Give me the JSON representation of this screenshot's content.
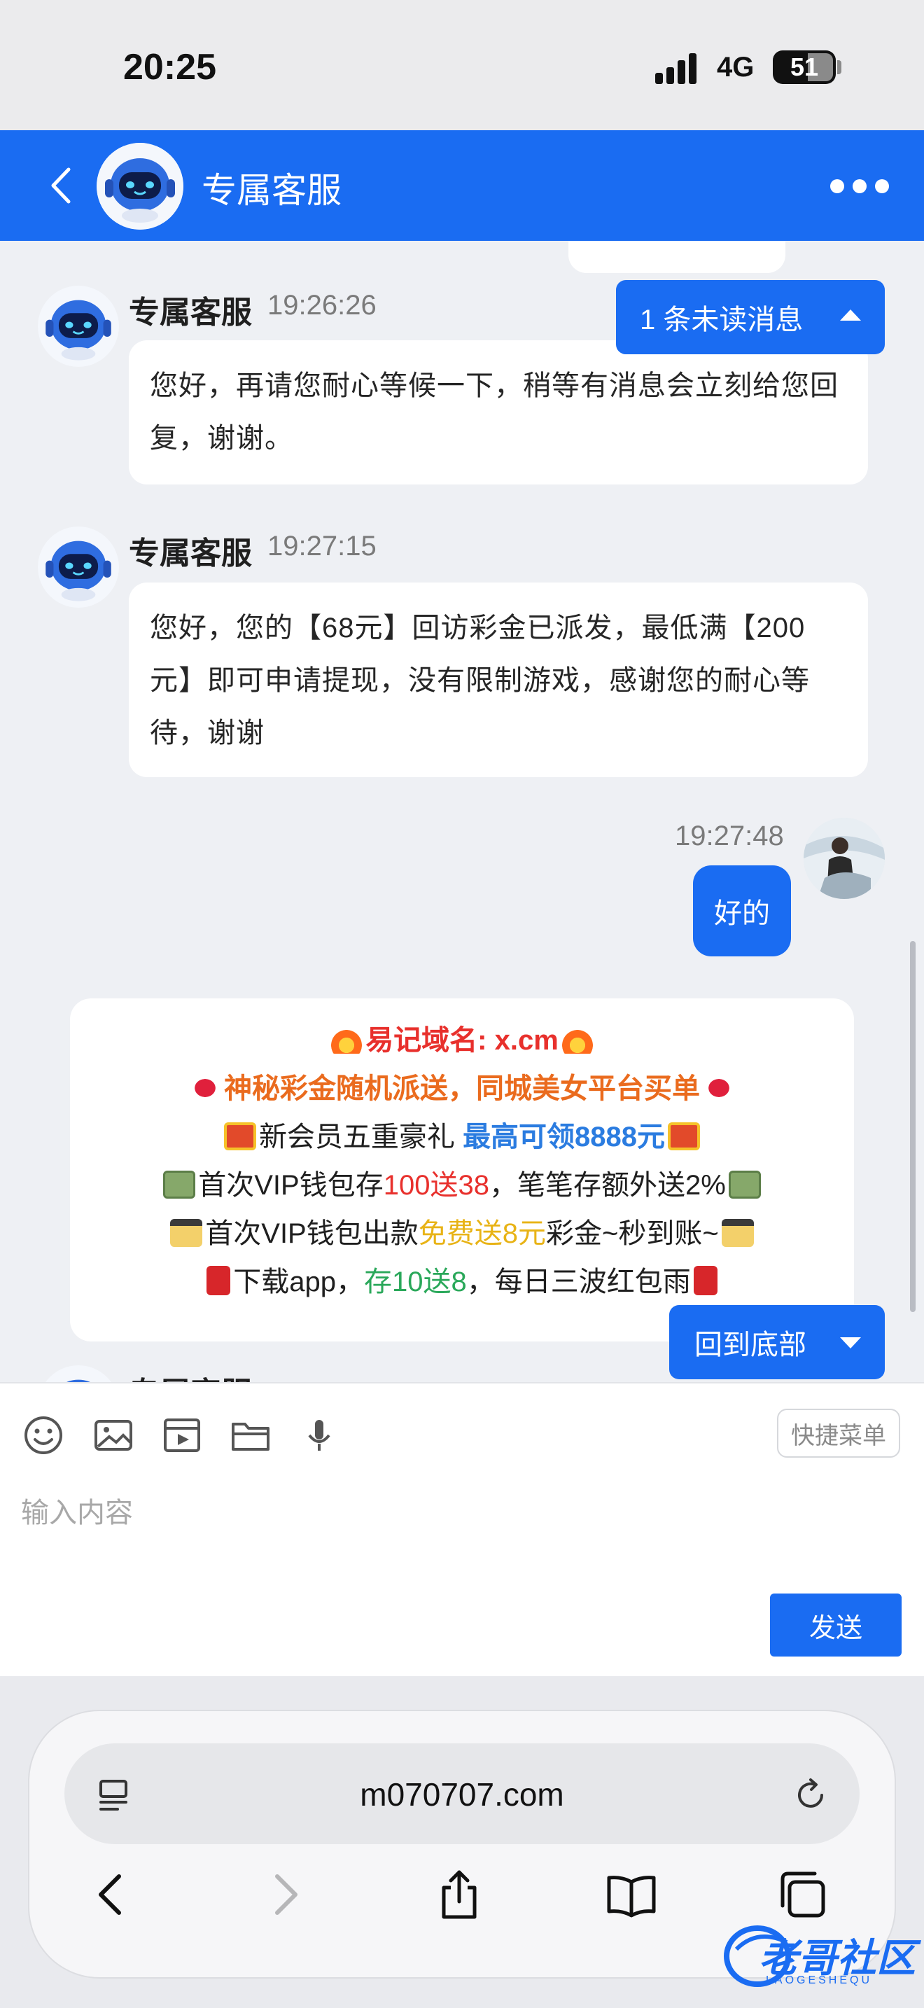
{
  "status_bar": {
    "time": "20:25",
    "network": "4G",
    "battery": "51"
  },
  "header": {
    "title": "专属客服"
  },
  "messages": [
    {
      "sender": "专属客服",
      "time": "19:26:26",
      "text": "您好，再请您耐心等候一下，稍等有消息会立刻给您回复，谢谢。"
    },
    {
      "sender": "专属客服",
      "time": "19:27:15",
      "text": "您好，您的【68元】回访彩金已派发，最低满【200元】即可申请提现，没有限制游戏，感谢您的耐心等待，谢谢"
    },
    {
      "sender": "me",
      "time": "19:27:48",
      "text": "好的"
    }
  ],
  "promo": {
    "line1": "易记域名: x.cm",
    "line2": "神秘彩金随机派送，同城美女平台买单",
    "line3_a": "新会员五重豪礼 ",
    "line3_b": "最高可领8888元",
    "line4_a": "首次VIP钱包存",
    "line4_b": "100送38",
    "line4_c": "，笔笔存额外送2%",
    "line5_a": "首次VIP钱包出款",
    "line5_b": "免费送8元",
    "line5_c": "彩金~秒到账~",
    "line6_a": "下载app，",
    "line6_b": "存10送8",
    "line6_c": "，每日三波红包雨"
  },
  "partial_sender": "专属客服",
  "floating": {
    "unread": "1 条未读消息",
    "to_bottom": "回到底部"
  },
  "input": {
    "quick_menu": "快捷菜单",
    "placeholder": "输入内容",
    "send": "发送"
  },
  "browser": {
    "url": "m070707.com"
  },
  "watermark": {
    "text": "老哥社区",
    "sub": "LAOGESHEQU"
  },
  "colors": {
    "brand_blue": "#1a6cf2",
    "accent_red": "#e8302c",
    "accent_orange": "#ea6b1e",
    "accent_green": "#2aa85a",
    "accent_gold": "#e8b316"
  },
  "icons": [
    "back-icon",
    "robot-icon",
    "more-icon",
    "emoji-icon",
    "image-icon",
    "video-icon",
    "folder-icon",
    "mic-icon",
    "reader-icon",
    "reload-icon",
    "share-icon",
    "bookmarks-icon",
    "tabs-icon"
  ]
}
